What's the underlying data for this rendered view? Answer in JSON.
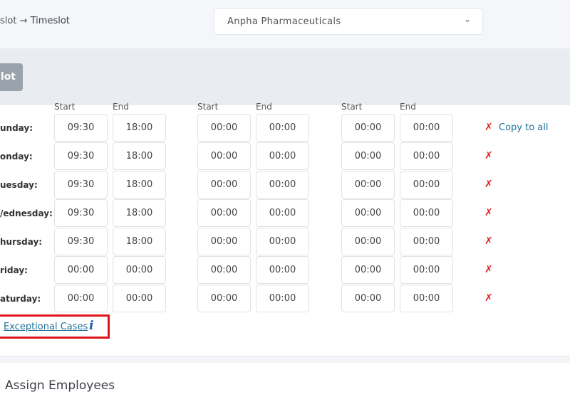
{
  "header": {
    "breadcrumb_prev": "slot",
    "breadcrumb_arrow": "→",
    "breadcrumb_current": "Timeslot",
    "company_select_value": "Anpha Pharmaceuticals",
    "chevron": "⌄"
  },
  "actionbar": {
    "button_label": "lot"
  },
  "columns": [
    "Start",
    "End",
    "Start",
    "End",
    "Start",
    "End"
  ],
  "schedule": [
    {
      "day": "unday:",
      "times": [
        "09:30",
        "18:00",
        "00:00",
        "00:00",
        "00:00",
        "00:00"
      ]
    },
    {
      "day": "onday:",
      "times": [
        "09:30",
        "18:00",
        "00:00",
        "00:00",
        "00:00",
        "00:00"
      ]
    },
    {
      "day": "uesday:",
      "times": [
        "09:30",
        "18:00",
        "00:00",
        "00:00",
        "00:00",
        "00:00"
      ]
    },
    {
      "day": "/ednesday:",
      "times": [
        "09:30",
        "18:00",
        "00:00",
        "00:00",
        "00:00",
        "00:00"
      ]
    },
    {
      "day": "hursday:",
      "times": [
        "09:30",
        "18:00",
        "00:00",
        "00:00",
        "00:00",
        "00:00"
      ]
    },
    {
      "day": "riday:",
      "times": [
        "00:00",
        "00:00",
        "00:00",
        "00:00",
        "00:00",
        "00:00"
      ]
    },
    {
      "day": "aturday:",
      "times": [
        "00:00",
        "00:00",
        "00:00",
        "00:00",
        "00:00",
        "00:00"
      ]
    }
  ],
  "copy_all_label": "Copy to all",
  "x_glyph": "✗",
  "exceptional_cases_label": "Exceptional Cases",
  "info_glyph": "i",
  "assign_employees_title": "Assign Employees",
  "colors": {
    "accent_link": "#1f6f9a",
    "remove_red": "#e02020",
    "highlight_red": "#e0141b"
  },
  "icons": {
    "remove": "remove-x-icon",
    "info": "info-icon",
    "dropdown": "chevron-down-icon"
  }
}
